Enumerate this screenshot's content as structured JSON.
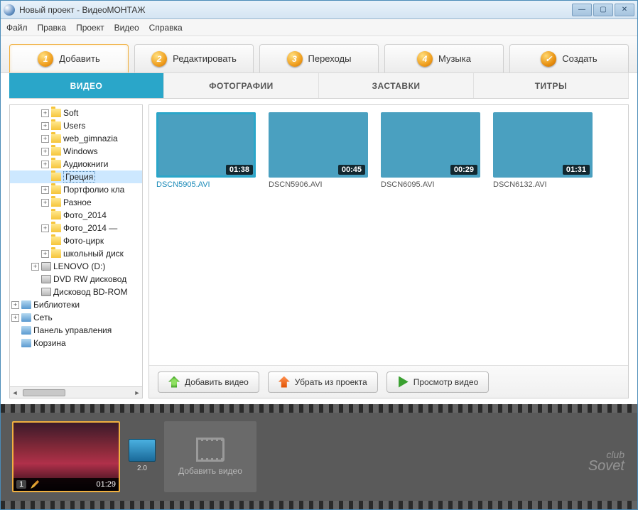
{
  "window": {
    "title": "Новый проект - ВидеоМОНТАЖ"
  },
  "menu": {
    "file": "Файл",
    "edit": "Правка",
    "project": "Проект",
    "video": "Видео",
    "help": "Справка"
  },
  "steps": [
    {
      "num": "1",
      "label": "Добавить",
      "active": true
    },
    {
      "num": "2",
      "label": "Редактировать"
    },
    {
      "num": "3",
      "label": "Переходы"
    },
    {
      "num": "4",
      "label": "Музыка"
    },
    {
      "num": "✓",
      "label": "Создать"
    }
  ],
  "subtabs": {
    "video": "ВИДЕО",
    "photos": "ФОТОГРАФИИ",
    "splash": "ЗАСТАВКИ",
    "titles": "ТИТРЫ"
  },
  "tree": [
    {
      "indent": 3,
      "toggle": "+",
      "icon": "folder",
      "label": "Soft"
    },
    {
      "indent": 3,
      "toggle": "+",
      "icon": "folder",
      "label": "Users"
    },
    {
      "indent": 3,
      "toggle": "+",
      "icon": "folder",
      "label": "web_gimnazia"
    },
    {
      "indent": 3,
      "toggle": "+",
      "icon": "folder",
      "label": "Windows"
    },
    {
      "indent": 3,
      "toggle": "+",
      "icon": "folder",
      "label": "Аудиокниги"
    },
    {
      "indent": 3,
      "toggle": " ",
      "icon": "folder",
      "label": "Греция",
      "selected": true
    },
    {
      "indent": 3,
      "toggle": "+",
      "icon": "folder",
      "label": "Портфолио кла"
    },
    {
      "indent": 3,
      "toggle": "+",
      "icon": "folder",
      "label": "Разное"
    },
    {
      "indent": 3,
      "toggle": " ",
      "icon": "folder",
      "label": "Фото_2014"
    },
    {
      "indent": 3,
      "toggle": "+",
      "icon": "folder",
      "label": "Фото_2014 —"
    },
    {
      "indent": 3,
      "toggle": " ",
      "icon": "folder",
      "label": "Фото-цирк"
    },
    {
      "indent": 3,
      "toggle": "+",
      "icon": "folder",
      "label": "школьный диск"
    },
    {
      "indent": 2,
      "toggle": "+",
      "icon": "drive",
      "label": "LENOVO (D:)"
    },
    {
      "indent": 2,
      "toggle": " ",
      "icon": "drive",
      "label": "DVD RW дисковод"
    },
    {
      "indent": 2,
      "toggle": " ",
      "icon": "drive",
      "label": "Дисковод BD-ROM"
    },
    {
      "indent": 0,
      "toggle": "+",
      "icon": "lib",
      "label": "Библиотеки"
    },
    {
      "indent": 0,
      "toggle": "+",
      "icon": "lib",
      "label": "Сеть"
    },
    {
      "indent": 0,
      "toggle": " ",
      "icon": "lib",
      "label": "Панель управления"
    },
    {
      "indent": 0,
      "toggle": " ",
      "icon": "lib",
      "label": "Корзина"
    }
  ],
  "thumbs": [
    {
      "time": "01:38",
      "name": "DSCN5905.AVI",
      "cls": "pool1",
      "selected": true
    },
    {
      "time": "00:45",
      "name": "DSCN5906.AVI",
      "cls": "pool2"
    },
    {
      "time": "00:29",
      "name": "DSCN6095.AVI",
      "cls": "pool3"
    },
    {
      "time": "01:31",
      "name": "DSCN6132.AVI",
      "cls": "outdoor"
    }
  ],
  "buttons": {
    "add": "Добавить видео",
    "remove": "Убрать из проекта",
    "preview": "Просмотр видео"
  },
  "timeline": {
    "clip": {
      "index": "1",
      "duration": "01:29"
    },
    "transition_value": "2.0",
    "add_slot": "Добавить видео"
  },
  "watermark": {
    "l1": "club",
    "l2": "Sovet"
  }
}
